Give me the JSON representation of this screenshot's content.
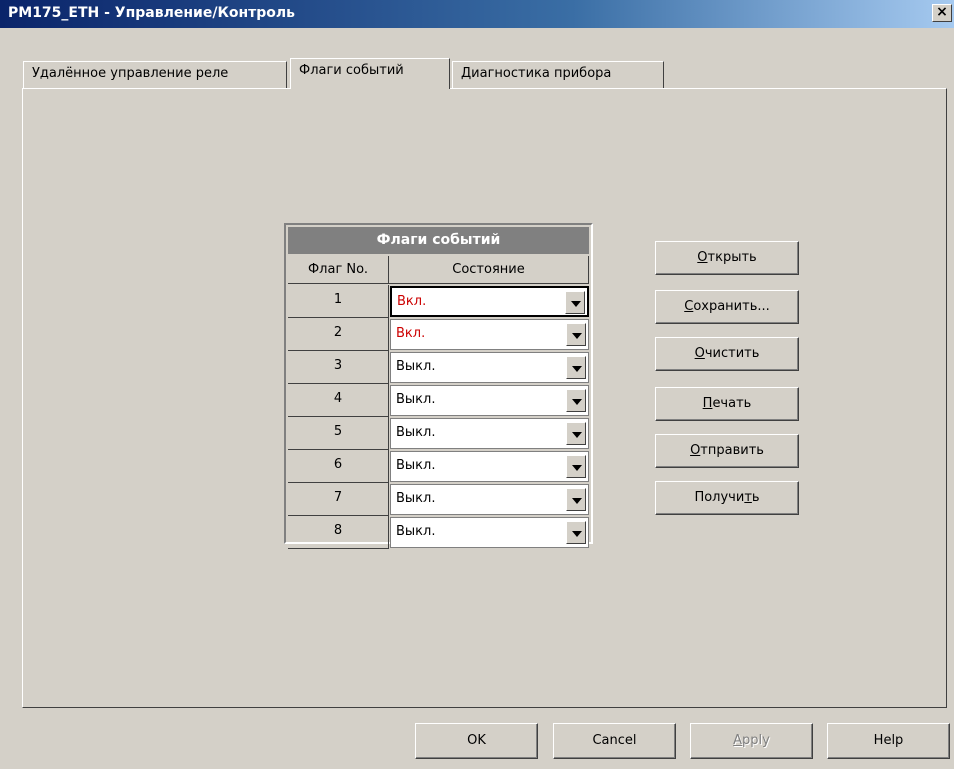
{
  "window": {
    "title": "PM175_ETH - Управление/Контроль",
    "close_label": "×"
  },
  "tabs": [
    {
      "label": "Удалённое управление реле",
      "active": false
    },
    {
      "label": "Флаги событий",
      "active": true
    },
    {
      "label": "Диагностика прибора",
      "active": false
    }
  ],
  "grid": {
    "title": "Флаги событий",
    "headers": {
      "flag_no": "Флаг No.",
      "state": "Состояние"
    },
    "rows": [
      {
        "no": "1",
        "state": "Вкл.",
        "color": "#cc0000"
      },
      {
        "no": "2",
        "state": "Вкл.",
        "color": "#cc0000"
      },
      {
        "no": "3",
        "state": "Выкл.",
        "color": "#000000"
      },
      {
        "no": "4",
        "state": "Выкл.",
        "color": "#000000"
      },
      {
        "no": "5",
        "state": "Выкл.",
        "color": "#000000"
      },
      {
        "no": "6",
        "state": "Выкл.",
        "color": "#000000"
      },
      {
        "no": "7",
        "state": "Выкл.",
        "color": "#000000"
      },
      {
        "no": "8",
        "state": "Выкл.",
        "color": "#000000"
      }
    ]
  },
  "actions": {
    "open": {
      "mnemonic": "О",
      "rest": "ткрыть"
    },
    "save": {
      "mnemonic": "С",
      "rest": "охранить..."
    },
    "clear": {
      "mnemonic": "О",
      "rest": "чистить"
    },
    "print": {
      "mnemonic": "П",
      "rest": "ечать"
    },
    "send": {
      "mnemonic": "О",
      "rest": "тправить"
    },
    "receive": {
      "pre": "Получи",
      "mnemonic": "т",
      "rest": "ь"
    }
  },
  "dialog_buttons": {
    "ok": "OK",
    "cancel": "Cancel",
    "apply": {
      "mnemonic": "A",
      "rest": "pply",
      "disabled": true
    },
    "help": "Help"
  },
  "colors": {
    "window_bg": "#d4d0c8",
    "titlebar_start": "#0a246a",
    "titlebar_end": "#a6caf0",
    "on_state": "#cc0000",
    "grid_header": "#808080"
  }
}
